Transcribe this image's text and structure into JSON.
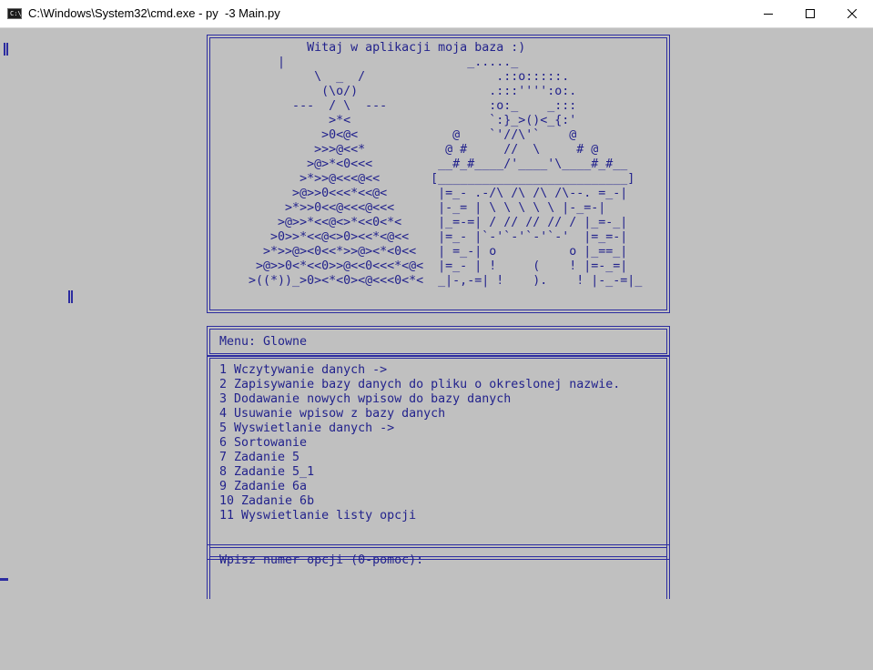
{
  "window": {
    "title": "C:\\Windows\\System32\\cmd.exe - py  -3 Main.py",
    "icon_label": "C:\\",
    "controls": [
      "minimize-icon",
      "maximize-icon",
      "close-icon"
    ]
  },
  "banner": {
    "art": "             Witaj w aplikacji moja baza :)\n         |                         _....._\n              \\  _  /                  .::o:::::.\n               (\\o/)                  .:::'''':o:.\n           ---  / \\  ---              :o:_    _:::\n                >*<                   `:}_>()<_{:'\n               >0<@<             @    `'//\\'`    @\n              >>>@<<*           @ #     //  \\     # @\n             >@>*<0<<<         __#_#____/'____'\\____#_#__\n            >*>>@<<<@<<       [__________________________]\n           >@>>0<<<*<<@<       |=_- .-/\\ /\\ /\\ /\\--. =_-|\n          >*>>0<<@<<<@<<<      |-_= | \\ \\ \\ \\ \\ |-_=-|\n         >@>>*<<@<>*<<0<*<     |_=-=| / // // // / |_=-_|\n        >0>>*<<@<>0><<*<@<<    |=_- |`-'`-'`-'`-'  |=_=-|\n       >*>>@><0<<*>>@><*<0<<   | =_-| o          o |_==_|\n      >@>>0<*<<0>>@<<0<<<*<@<  |=_- | !     (    ! |=-_=|\n     >((*))_>0><*<0><@<<<0<*<  _|-,-=| !    ).    ! |-_-=|_"
  },
  "menu": {
    "title": "Menu: Glowne",
    "items": [
      "1 Wczytywanie danych ->",
      "2 Zapisywanie bazy danych do pliku o okreslonej nazwie.",
      "3 Dodawanie nowych wpisow do bazy danych",
      "4 Usuwanie wpisow z bazy danych",
      "5 Wyswietlanie danych ->",
      "6 Sortowanie",
      "7 Zadanie 5",
      "8 Zadanie 5_1",
      "9 Zadanie 6a",
      "10 Zadanie 6b",
      "11 Wyswietlanie listy opcji"
    ]
  },
  "prompt": {
    "text": "Wpisz numer opcji (0-pomoc):"
  },
  "colors": {
    "console_bg": "#c0c0c0",
    "console_fg": "#22228c",
    "titlebar_bg": "#ffffff"
  }
}
